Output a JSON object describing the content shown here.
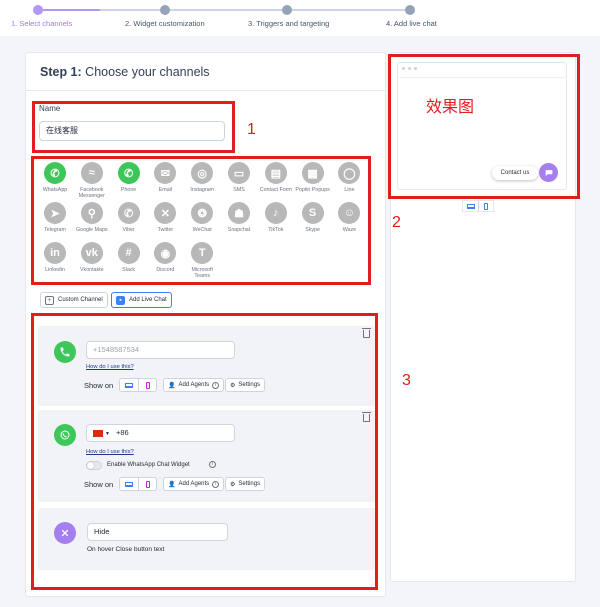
{
  "steps": [
    {
      "label": "1. Select channels",
      "active": true
    },
    {
      "label": "2. Widget customization",
      "active": false
    },
    {
      "label": "3. Triggers and targeting",
      "active": false
    },
    {
      "label": "4. Add live chat",
      "active": false
    }
  ],
  "step_title": {
    "prefix": "Step 1:",
    "text": " Choose your channels"
  },
  "name_field": {
    "label": "Name",
    "value": "在线客服"
  },
  "channels": [
    {
      "name": "WhatsApp",
      "icon": "whatsapp-icon",
      "selected": true
    },
    {
      "name": "Facebook Messenger",
      "icon": "messenger-icon",
      "selected": false
    },
    {
      "name": "Phone",
      "icon": "phone-icon",
      "selected": true
    },
    {
      "name": "Email",
      "icon": "email-icon",
      "selected": false
    },
    {
      "name": "Instagram",
      "icon": "instagram-icon",
      "selected": false
    },
    {
      "name": "SMS",
      "icon": "sms-icon",
      "selected": false
    },
    {
      "name": "Contact Form",
      "icon": "contact-form-icon",
      "selected": false
    },
    {
      "name": "Poptin Popups",
      "icon": "poptin-icon",
      "selected": false
    },
    {
      "name": "Line",
      "icon": "line-icon",
      "selected": false
    },
    {
      "name": "Telegram",
      "icon": "telegram-icon",
      "selected": false
    },
    {
      "name": "Google Maps",
      "icon": "google-maps-icon",
      "selected": false
    },
    {
      "name": "Viber",
      "icon": "viber-icon",
      "selected": false
    },
    {
      "name": "Twitter",
      "icon": "twitter-icon",
      "selected": false
    },
    {
      "name": "WeChat",
      "icon": "wechat-icon",
      "selected": false
    },
    {
      "name": "Snapchat",
      "icon": "snapchat-icon",
      "selected": false
    },
    {
      "name": "TikTok",
      "icon": "tiktok-icon",
      "selected": false
    },
    {
      "name": "Skype",
      "icon": "skype-icon",
      "selected": false
    },
    {
      "name": "Waze",
      "icon": "waze-icon",
      "selected": false
    },
    {
      "name": "Linkedin",
      "icon": "linkedin-icon",
      "selected": false
    },
    {
      "name": "Vkontakte",
      "icon": "vkontakte-icon",
      "selected": false
    },
    {
      "name": "Slack",
      "icon": "slack-icon",
      "selected": false
    },
    {
      "name": "Discord",
      "icon": "discord-icon",
      "selected": false
    },
    {
      "name": "Microsoft Teams",
      "icon": "microsoft-teams-icon",
      "selected": false
    }
  ],
  "buttons": {
    "custom_channel": "Custom Channel",
    "add_live_chat": "Add Live Chat"
  },
  "phone_card": {
    "placeholder": "+1548587534",
    "howto": "How do I use this?",
    "show_on": "Show on",
    "add_agents": "Add Agents",
    "settings": "Settings"
  },
  "whatsapp_card": {
    "country_code": "+86",
    "howto": "How do I use this?",
    "widget_toggle": "Enable WhatsApp Chat Widget",
    "show_on": "Show on",
    "add_agents": "Add Agents",
    "settings": "Settings"
  },
  "close_card": {
    "value": "Hide",
    "caption": "On hover Close button text"
  },
  "annotations": {
    "one": "1",
    "two": "2",
    "three": "3",
    "effect": "效果图"
  },
  "preview": {
    "contact": "Contact us"
  },
  "colors": {
    "accent": "#a57ff0",
    "whatsapp": "#3ec65a",
    "annotation": "#e11d1d"
  }
}
